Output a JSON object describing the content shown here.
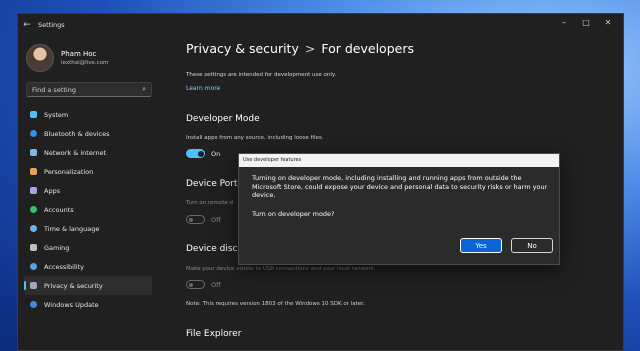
{
  "window": {
    "title": "Settings",
    "back_glyph": "←",
    "controls": [
      "–",
      "□",
      "✕"
    ]
  },
  "profile": {
    "name": "Pham Hoc",
    "email": "lexthai@live.com"
  },
  "search": {
    "placeholder": "Find a setting",
    "icon": "search-icon"
  },
  "nav": [
    {
      "label": "System",
      "icon": "monitor-icon",
      "color": "#4cc2ff",
      "active": false
    },
    {
      "label": "Bluetooth & devices",
      "icon": "bluetooth-icon",
      "color": "#3a8dde",
      "active": false
    },
    {
      "label": "Network & internet",
      "icon": "wifi-icon",
      "color": "#7fb8e8",
      "active": false
    },
    {
      "label": "Personalization",
      "icon": "brush-icon",
      "color": "#e8a15a",
      "active": false
    },
    {
      "label": "Apps",
      "icon": "apps-icon",
      "color": "#a5a5e8",
      "active": false
    },
    {
      "label": "Accounts",
      "icon": "person-icon",
      "color": "#3dbf6a",
      "active": false
    },
    {
      "label": "Time & language",
      "icon": "globe-icon",
      "color": "#6fb3e8",
      "active": false
    },
    {
      "label": "Gaming",
      "icon": "gamepad-icon",
      "color": "#bfbfbf",
      "active": false
    },
    {
      "label": "Accessibility",
      "icon": "accessibility-icon",
      "color": "#4fa3e8",
      "active": false
    },
    {
      "label": "Privacy & security",
      "icon": "shield-icon",
      "color": "#9fa8b5",
      "active": true
    },
    {
      "label": "Windows Update",
      "icon": "update-icon",
      "color": "#3a8dde",
      "active": false
    }
  ],
  "content": {
    "breadcrumb_parent": "Privacy & security",
    "breadcrumb_sep": ">",
    "breadcrumb_current": "For developers",
    "intro": "These settings are intended for development use only.",
    "learn_more": "Learn more",
    "developer_mode": {
      "title": "Developer Mode",
      "desc": "Install apps from any source, including loose files.",
      "state": "On"
    },
    "device_portal": {
      "title": "Device Porta",
      "desc": "Turn on remote d",
      "state": "Off"
    },
    "device_discovery": {
      "title": "Device disco",
      "desc": "Make your device visible to USB connections and your local network.",
      "state": "Off",
      "note": "Note: This requires version 1803 of the Windows 10 SDK or later."
    },
    "file_explorer": {
      "title": "File Explorer"
    }
  },
  "dialog": {
    "title": "Use developer features",
    "message": "Turning on developer mode, including installing and running apps from outside the Microsoft Store, could expose your device and personal data to security risks or harm your device.",
    "question": "Turn on developer mode?",
    "yes": "Yes",
    "no": "No"
  },
  "colors": {
    "accent": "#4cc2ff",
    "background": "#202020",
    "dialog_button": "#0a64d8"
  }
}
